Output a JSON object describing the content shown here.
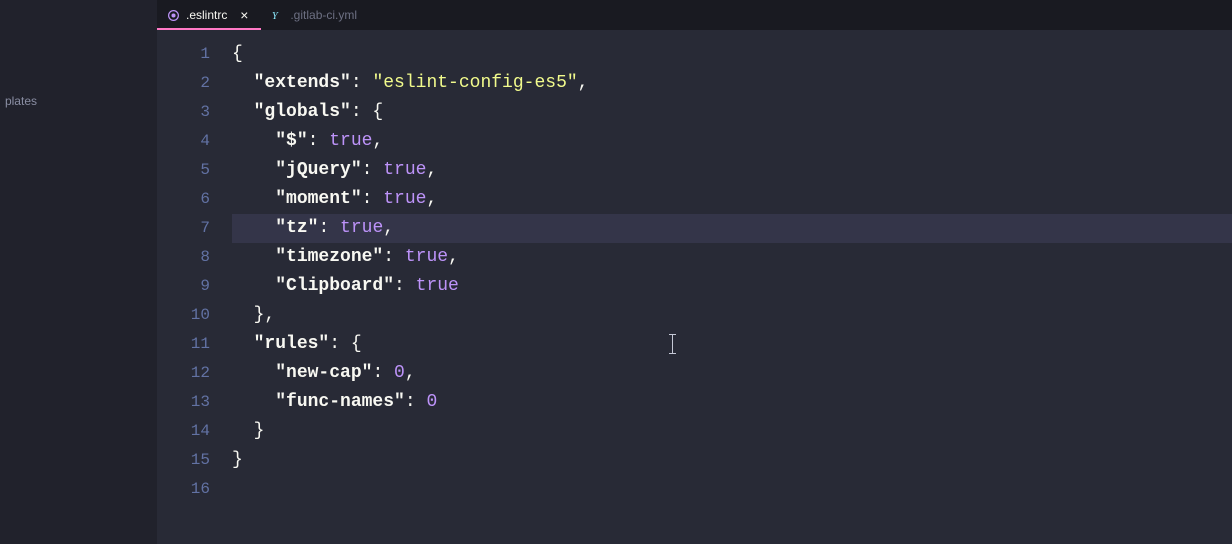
{
  "sidebar": {
    "items": [
      {
        "label": "plates"
      }
    ]
  },
  "tabs": [
    {
      "name": ".eslintrc",
      "active": true,
      "dirty": false,
      "iconColor": "#bd93f9"
    },
    {
      "name": ".gitlab-ci.yml",
      "active": false,
      "dirty": false,
      "iconColor": "#8be9fd"
    }
  ],
  "editor": {
    "highlightLine": 7,
    "cursor": {
      "line": 11,
      "colPx": 440
    },
    "lines": [
      {
        "n": 1,
        "tokens": [
          {
            "t": "{",
            "c": "punc"
          }
        ]
      },
      {
        "n": 2,
        "tokens": [
          {
            "t": "  ",
            "c": "punc"
          },
          {
            "t": "\"extends\"",
            "c": "key"
          },
          {
            "t": ": ",
            "c": "punc"
          },
          {
            "t": "\"eslint-config-es5\"",
            "c": "str"
          },
          {
            "t": ",",
            "c": "punc"
          }
        ]
      },
      {
        "n": 3,
        "tokens": [
          {
            "t": "  ",
            "c": "punc"
          },
          {
            "t": "\"globals\"",
            "c": "key"
          },
          {
            "t": ": {",
            "c": "punc"
          }
        ]
      },
      {
        "n": 4,
        "tokens": [
          {
            "t": "    ",
            "c": "punc"
          },
          {
            "t": "\"$\"",
            "c": "key"
          },
          {
            "t": ": ",
            "c": "punc"
          },
          {
            "t": "true",
            "c": "kw"
          },
          {
            "t": ",",
            "c": "punc"
          }
        ]
      },
      {
        "n": 5,
        "tokens": [
          {
            "t": "    ",
            "c": "punc"
          },
          {
            "t": "\"jQuery\"",
            "c": "key"
          },
          {
            "t": ": ",
            "c": "punc"
          },
          {
            "t": "true",
            "c": "kw"
          },
          {
            "t": ",",
            "c": "punc"
          }
        ]
      },
      {
        "n": 6,
        "tokens": [
          {
            "t": "    ",
            "c": "punc"
          },
          {
            "t": "\"moment\"",
            "c": "key"
          },
          {
            "t": ": ",
            "c": "punc"
          },
          {
            "t": "true",
            "c": "kw"
          },
          {
            "t": ",",
            "c": "punc"
          }
        ]
      },
      {
        "n": 7,
        "tokens": [
          {
            "t": "    ",
            "c": "punc"
          },
          {
            "t": "\"tz\"",
            "c": "key"
          },
          {
            "t": ": ",
            "c": "punc"
          },
          {
            "t": "true",
            "c": "kw"
          },
          {
            "t": ",",
            "c": "punc"
          }
        ]
      },
      {
        "n": 8,
        "tokens": [
          {
            "t": "    ",
            "c": "punc"
          },
          {
            "t": "\"timezone\"",
            "c": "key"
          },
          {
            "t": ": ",
            "c": "punc"
          },
          {
            "t": "true",
            "c": "kw"
          },
          {
            "t": ",",
            "c": "punc"
          }
        ]
      },
      {
        "n": 9,
        "tokens": [
          {
            "t": "    ",
            "c": "punc"
          },
          {
            "t": "\"Clipboard\"",
            "c": "key"
          },
          {
            "t": ": ",
            "c": "punc"
          },
          {
            "t": "true",
            "c": "kw"
          }
        ]
      },
      {
        "n": 10,
        "tokens": [
          {
            "t": "  },",
            "c": "punc"
          }
        ]
      },
      {
        "n": 11,
        "tokens": [
          {
            "t": "  ",
            "c": "punc"
          },
          {
            "t": "\"rules\"",
            "c": "key"
          },
          {
            "t": ": {",
            "c": "punc"
          }
        ]
      },
      {
        "n": 12,
        "tokens": [
          {
            "t": "    ",
            "c": "punc"
          },
          {
            "t": "\"new-cap\"",
            "c": "key"
          },
          {
            "t": ": ",
            "c": "punc"
          },
          {
            "t": "0",
            "c": "num"
          },
          {
            "t": ",",
            "c": "punc"
          }
        ]
      },
      {
        "n": 13,
        "tokens": [
          {
            "t": "    ",
            "c": "punc"
          },
          {
            "t": "\"func-names\"",
            "c": "key"
          },
          {
            "t": ": ",
            "c": "punc"
          },
          {
            "t": "0",
            "c": "num"
          }
        ]
      },
      {
        "n": 14,
        "tokens": [
          {
            "t": "  }",
            "c": "punc"
          }
        ]
      },
      {
        "n": 15,
        "tokens": [
          {
            "t": "}",
            "c": "punc"
          }
        ]
      },
      {
        "n": 16,
        "tokens": []
      }
    ]
  }
}
